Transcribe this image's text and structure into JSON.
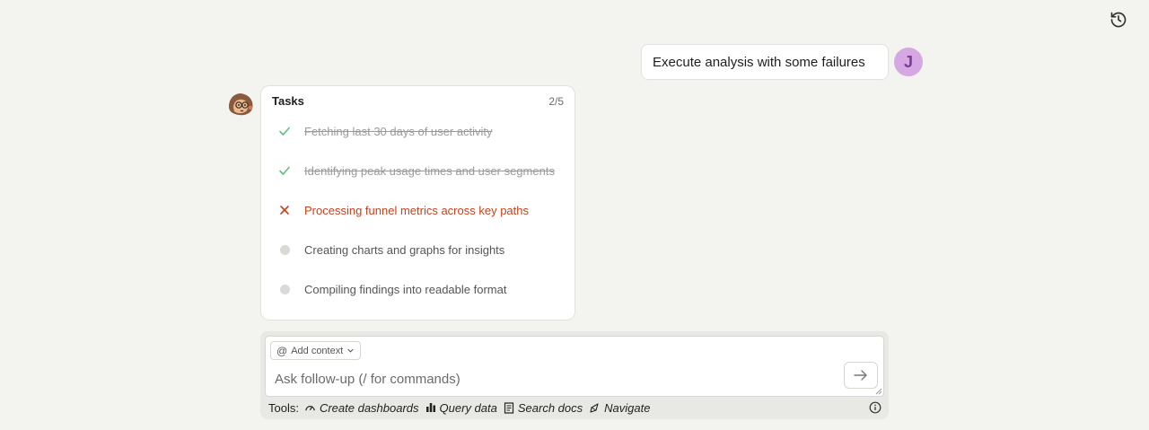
{
  "header": {
    "history_icon": "history-icon"
  },
  "user_message": {
    "text": "Execute analysis with some failures",
    "avatar_initial": "J",
    "avatar_color": "#d5a8e3"
  },
  "tasks": {
    "title": "Tasks",
    "count": "2/5",
    "items": [
      {
        "label": "Fetching last 30 days of user activity",
        "status": "done",
        "icon": "check-icon"
      },
      {
        "label": "Identifying peak usage times and user segments",
        "status": "done",
        "icon": "check-icon"
      },
      {
        "label": "Processing funnel metrics across key paths",
        "status": "failed",
        "icon": "x-icon"
      },
      {
        "label": "Creating charts and graphs for insights",
        "status": "pending",
        "icon": "dot-icon"
      },
      {
        "label": "Compiling findings into readable format",
        "status": "pending",
        "icon": "dot-icon"
      }
    ],
    "colors": {
      "done": "#5bbf7d",
      "failed": "#c8401c",
      "pending": "#d9d9d6"
    }
  },
  "composer": {
    "add_context_label": "Add context",
    "placeholder": "Ask follow-up (/ for commands)",
    "value": "",
    "tools_label": "Tools:",
    "tools": [
      {
        "label": "Create dashboards",
        "icon": "dashboard-icon"
      },
      {
        "label": "Query data",
        "icon": "bar-chart-icon"
      },
      {
        "label": "Search docs",
        "icon": "document-icon"
      },
      {
        "label": "Navigate",
        "icon": "compass-icon"
      }
    ]
  }
}
